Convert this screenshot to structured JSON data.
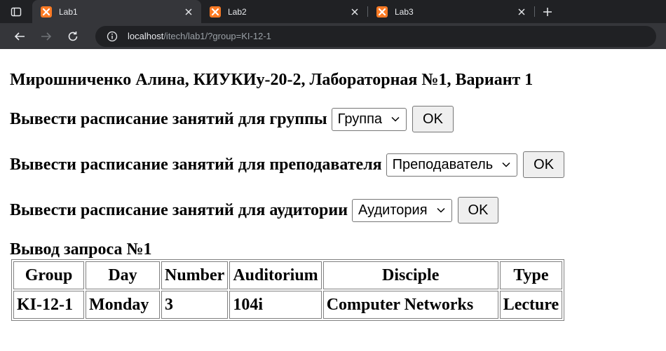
{
  "browser": {
    "tabs": [
      {
        "title": "Lab1",
        "active": true
      },
      {
        "title": "Lab2",
        "active": false
      },
      {
        "title": "Lab3",
        "active": false
      }
    ],
    "url_host": "localhost",
    "url_path": "/itech/lab1/?group=KI-12-1"
  },
  "page": {
    "heading": "Мирошниченко Алина, КИУКИу-20-2, Лабораторная №1, Вариант 1",
    "queries": [
      {
        "label": "Вывести расписание занятий для группы",
        "select_value": "Группа",
        "button": "OK"
      },
      {
        "label": "Вывести расписание занятий для преподавателя",
        "select_value": "Преподаватель",
        "button": "OK"
      },
      {
        "label": "Вывести расписание занятий для аудитории",
        "select_value": "Аудитория",
        "button": "OK"
      }
    ],
    "result_title": "Вывод запроса №1",
    "table": {
      "headers": [
        "Group",
        "Day",
        "Number",
        "Auditorium",
        "Disciple",
        "Type"
      ],
      "rows": [
        [
          "KI-12-1",
          "Monday",
          "3",
          "104i",
          "Computer Networks",
          "Lecture"
        ]
      ]
    }
  },
  "colors": {
    "tabbar_bg": "#202124",
    "toolbar_bg": "#35363a",
    "favicon": "#fb7a24"
  }
}
